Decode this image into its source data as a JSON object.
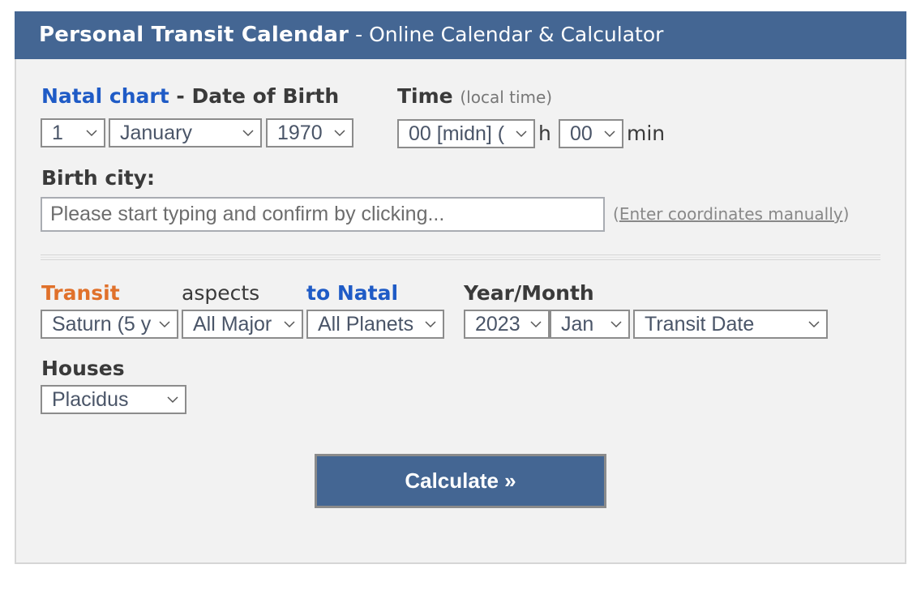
{
  "header": {
    "title": "Personal Transit Calendar",
    "separator": " - ",
    "subtitle": "Online Calendar & Calculator"
  },
  "natal": {
    "link_label": "Natal chart",
    "separator": " - ",
    "date_label": "Date of Birth",
    "day": "1",
    "month": "January",
    "year": "1970"
  },
  "time": {
    "label": "Time",
    "note": "(local time)",
    "hour": "00 [midn] (",
    "hour_unit": "h",
    "minute": "00",
    "minute_unit": "min"
  },
  "city": {
    "label": "Birth city:",
    "placeholder": "Please start typing and confirm by clicking...",
    "value": "",
    "coords_open": "(",
    "coords_link": "Enter coordinates manually",
    "coords_close": ")"
  },
  "transit": {
    "transit_label": "Transit",
    "aspects_label": "aspects",
    "to_natal_label": "to Natal",
    "planet": "Saturn (5 y",
    "aspects": "All Major",
    "natal_planets": "All Planets"
  },
  "yearmonth": {
    "label": "Year/Month",
    "year": "2023",
    "month": "Jan",
    "sort": "Transit Date"
  },
  "houses": {
    "label": "Houses",
    "system": "Placidus"
  },
  "actions": {
    "calculate_label": "Calculate »"
  },
  "colors": {
    "header_bg": "#446693",
    "link_blue": "#1f5bc6",
    "transit_orange": "#e0712b",
    "panel_bg": "#f2f2f2"
  }
}
